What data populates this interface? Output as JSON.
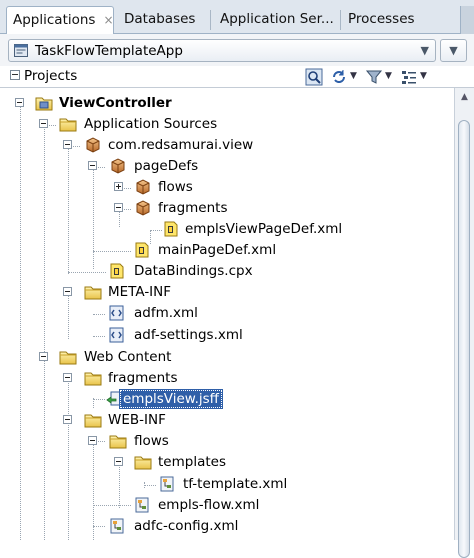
{
  "tabs": [
    {
      "label": "Applications",
      "close": "×",
      "active": true
    },
    {
      "label": "Databases"
    },
    {
      "label": "Application Ser..."
    },
    {
      "label": "Processes"
    }
  ],
  "app_selector": {
    "value": "TaskFlowTemplateApp"
  },
  "projects_panel": {
    "title": "Projects"
  },
  "tree": [
    {
      "label": "ViewController",
      "icon": "project-icon",
      "bold": true
    },
    {
      "label": "Application Sources",
      "icon": "folder-icon"
    },
    {
      "label": "com.redsamurai.view",
      "icon": "package-icon"
    },
    {
      "label": "pageDefs",
      "icon": "package-icon"
    },
    {
      "label": "flows",
      "icon": "package-icon"
    },
    {
      "label": "fragments",
      "icon": "package-icon"
    },
    {
      "label": "emplsViewPageDef.xml",
      "icon": "pagedef-icon"
    },
    {
      "label": "mainPageDef.xml",
      "icon": "pagedef-icon"
    },
    {
      "label": "DataBindings.cpx",
      "icon": "pagedef-icon"
    },
    {
      "label": "META-INF",
      "icon": "folder-icon"
    },
    {
      "label": "adfm.xml",
      "icon": "xml-icon"
    },
    {
      "label": "adf-settings.xml",
      "icon": "xml-icon"
    },
    {
      "label": "Web Content",
      "icon": "folder-icon"
    },
    {
      "label": "fragments",
      "icon": "folder-icon"
    },
    {
      "label": "emplsView.jsff",
      "icon": "jsff-icon",
      "selected": true
    },
    {
      "label": "WEB-INF",
      "icon": "folder-icon"
    },
    {
      "label": "flows",
      "icon": "folder-icon"
    },
    {
      "label": "templates",
      "icon": "folder-icon"
    },
    {
      "label": "tf-template.xml",
      "icon": "taskflow-icon"
    },
    {
      "label": "empls-flow.xml",
      "icon": "taskflow-icon"
    },
    {
      "label": "adfc-config.xml",
      "icon": "taskflow-icon"
    }
  ]
}
